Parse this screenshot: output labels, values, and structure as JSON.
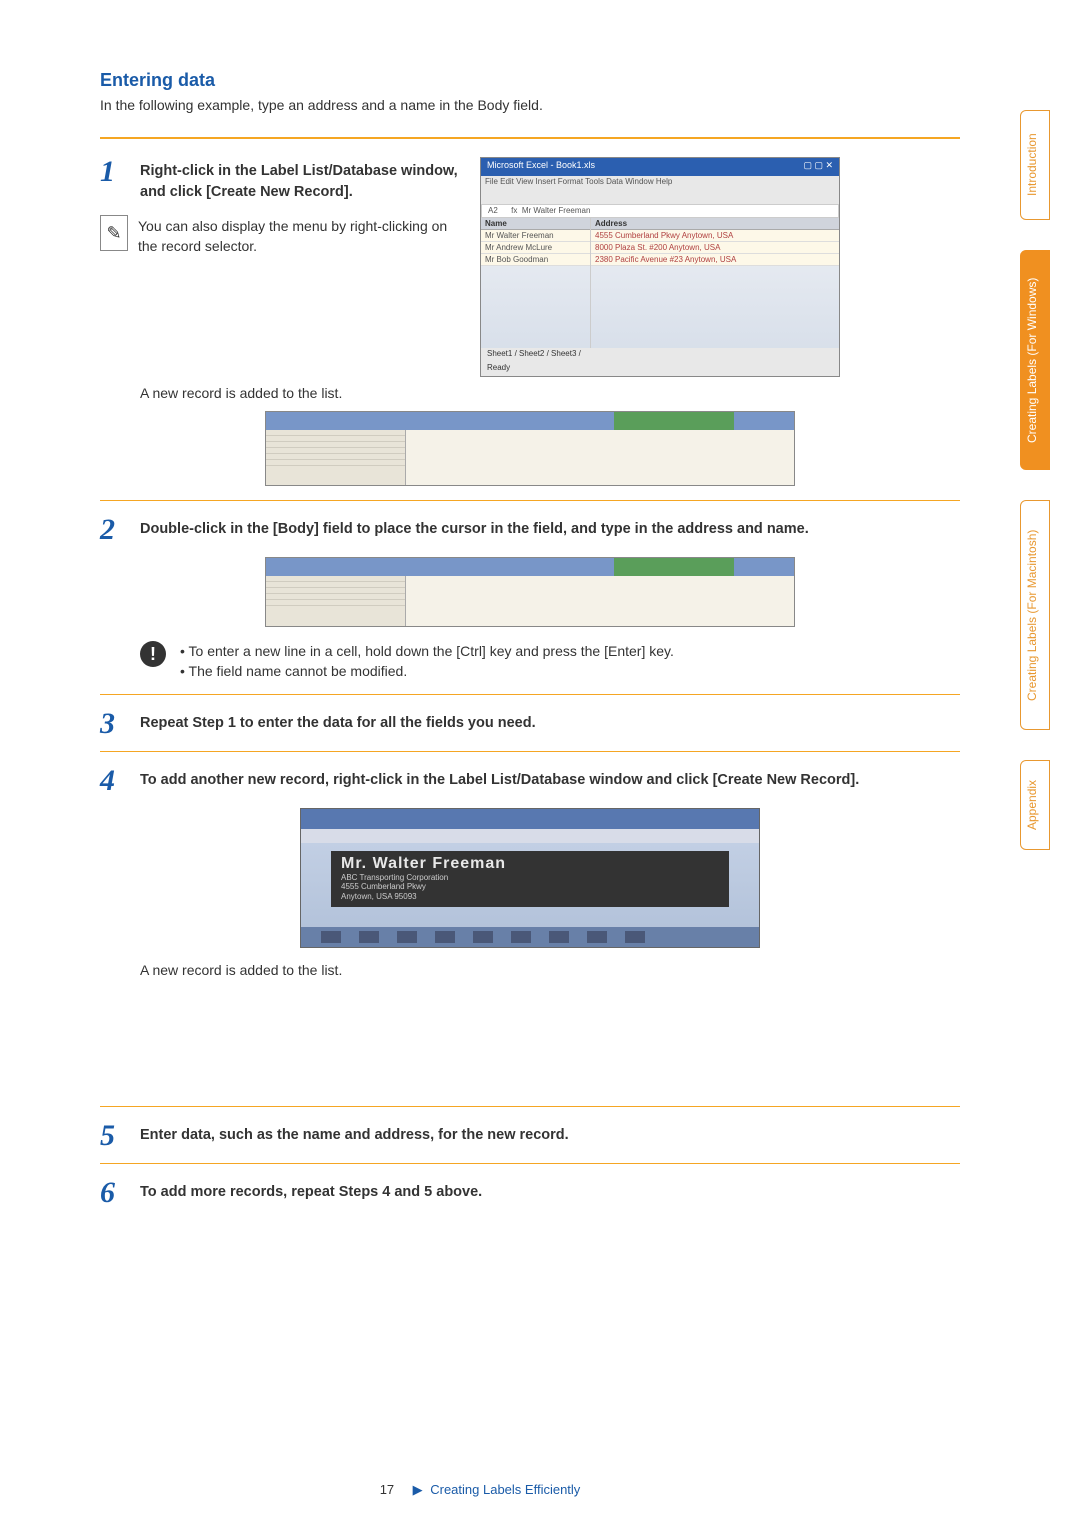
{
  "title": "Entering data",
  "intro": "In the following example, type an address and a name in the Body field.",
  "steps": {
    "s1": {
      "num": "1",
      "text": "Right-click in the Label List/Database window, and click [Create New Record].",
      "note": "You can also display the menu by right-clicking on the record selector.",
      "after": "A new record is added to the list."
    },
    "s2": {
      "num": "2",
      "text": "Double-click in the [Body] field to place the cursor in the field, and type in the address and name.",
      "warn1": "• To enter a new line in a cell, hold down the [Ctrl] key and press the [Enter] key.",
      "warn2": "• The field name cannot be modified."
    },
    "s3": {
      "num": "3",
      "text": "Repeat Step 1 to enter the data for all the fields you need."
    },
    "s4": {
      "num": "4",
      "text": "To add another new record, right-click in the Label List/Database window and click [Create New Record].",
      "after": "A new record is added to the list."
    },
    "s5": {
      "num": "5",
      "text": "Enter data, such as the name and address, for the new record."
    },
    "s6": {
      "num": "6",
      "text": "To add more records, repeat Steps 4 and 5 above."
    }
  },
  "excel": {
    "title": "Microsoft Excel - Book1.xls",
    "menu": "File  Edit  View  Insert  Format  Tools  Data  Window  Help",
    "formulaCell": "A2",
    "formulaVal": "Mr Walter Freeman",
    "hdrA": "Name",
    "hdrB": "Address",
    "rows": [
      {
        "a": "Mr Walter Freeman",
        "b": "4555 Cumberland Pkwy\nAnytown, USA"
      },
      {
        "a": "Mr Andrew McLure",
        "b": "8000 Plaza St. #200\nAnytown, USA"
      },
      {
        "a": "Mr Bob Goodman",
        "b": "2380 Pacific Avenue #23\nAnytown, USA"
      }
    ],
    "sheets": "Sheet1 / Sheet2 / Sheet3 /",
    "status": "Ready"
  },
  "label": {
    "name": "Mr. Walter Freeman",
    "line1": "ABC Transporting Corporation",
    "line2": "4555 Cumberland Pkwy",
    "line3": "Anytown, USA 95093"
  },
  "tabs": {
    "intro": "Introduction",
    "win": "Creating Labels (For Windows)",
    "mac": "Creating Labels (For Macintosh)",
    "apx": "Appendix"
  },
  "footer": {
    "page": "17",
    "arrow": "▶",
    "link": "Creating Labels Efficiently"
  }
}
